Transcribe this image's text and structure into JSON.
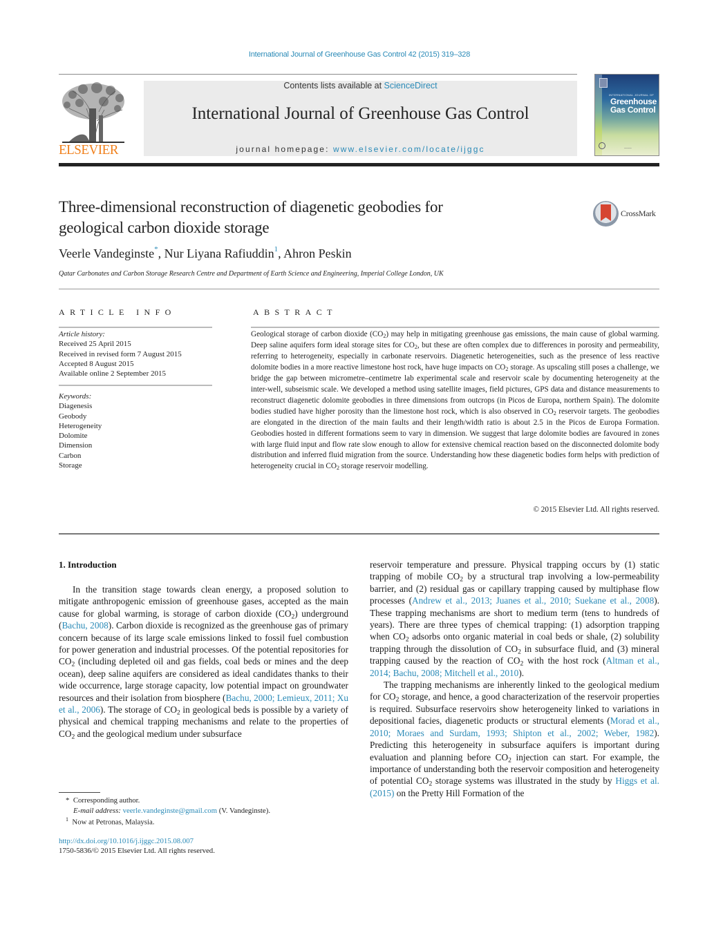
{
  "journal_citation": "International Journal of Greenhouse Gas Control 42 (2015) 319–328",
  "header": {
    "publisher_wordmark": "ELSEVIER",
    "contents_prefix": "Contents lists available at ",
    "contents_link": "ScienceDirect",
    "journal_title": "International Journal of Greenhouse Gas Control",
    "homepage_prefix": "journal homepage: ",
    "homepage_link": "www.elsevier.com/locate/ijggc",
    "cover": {
      "small_heading": "INTERNATIONAL JOURNAL OF",
      "title_line1": "Greenhouse",
      "title_line2": "Gas Control"
    }
  },
  "crossmark_label": "CrossMark",
  "article": {
    "title_line1": "Three-dimensional reconstruction of diagenetic geobodies for",
    "title_line2": "geological carbon dioxide storage",
    "authors": [
      {
        "name": "Veerle Vandeginste",
        "mark": "*"
      },
      {
        "name": "Nur Liyana Rafiuddin",
        "mark": "1"
      },
      {
        "name": "Ahron Peskin",
        "mark": ""
      }
    ],
    "affiliation": "Qatar Carbonates and Carbon Storage Research Centre and Department of Earth Science and Engineering, Imperial College London, UK"
  },
  "article_info": {
    "heading": "ARTICLE INFO",
    "history_label": "Article history:",
    "history": [
      "Received 25 April 2015",
      "Received in revised form 7 August 2015",
      "Accepted 8 August 2015",
      "Available online 2 September 2015"
    ],
    "keywords_label": "Keywords:",
    "keywords": [
      "Diagenesis",
      "Geobody",
      "Heterogeneity",
      "Dolomite",
      "Dimension",
      "Carbon",
      "Storage"
    ]
  },
  "abstract": {
    "heading": "ABSTRACT",
    "segments": [
      "Geological storage of carbon dioxide (CO",
      ") may help in mitigating greenhouse gas emissions, the main cause of global warming. Deep saline aquifers form ideal storage sites for CO",
      ", but these are often complex due to differences in porosity and permeability, referring to heterogeneity, especially in carbonate reservoirs. Diagenetic heterogeneities, such as the presence of less reactive dolomite bodies in a more reactive limestone host rock, have huge impacts on CO",
      " storage. As upscaling still poses a challenge, we bridge the gap between micrometre–centimetre lab experimental scale and reservoir scale by documenting heterogeneity at the inter-well, subseismic scale. We developed a method using satellite images, field pictures, GPS data and distance measurements to reconstruct diagenetic dolomite geobodies in three dimensions from outcrops (in Picos de Europa, northern Spain). The dolomite bodies studied have higher porosity than the limestone host rock, which is also observed in CO",
      " reservoir targets. The geobodies are elongated in the direction of the main faults and their length/width ratio is about 2.5 in the Picos de Europa Formation. Geobodies hosted in different formations seem to vary in dimension. We suggest that large dolomite bodies are favoured in zones with large fluid input and flow rate slow enough to allow for extensive chemical reaction based on the disconnected dolomite body distribution and inferred fluid migration from the source. Understanding how these diagenetic bodies form helps with prediction of heterogeneity crucial in CO",
      " storage reservoir modelling."
    ],
    "subscript": "2",
    "copyright": "© 2015 Elsevier Ltd. All rights reserved."
  },
  "introduction": {
    "heading": "1.  Introduction",
    "left_p1": [
      "In the transition stage towards clean energy, a proposed solution to mitigate anthropogenic emission of greenhouse gases, accepted as the main cause for global warming, is storage of carbon dioxide (CO",
      ") underground (",
      "). Carbon dioxide is recognized as the greenhouse gas of primary concern because of its large scale emissions linked to fossil fuel combustion for power generation and industrial processes. Of the potential repositories for CO",
      " (including depleted oil and gas fields, coal beds or mines and the deep ocean), deep saline aquifers are considered as ideal candidates thanks to their wide occurrence, large storage capacity, low potential impact on groundwater resources and their isolation from biosphere (",
      "). The storage of CO",
      " in geological beds is possible by a variety of physical and chemical trapping mechanisms and relate to the properties of CO",
      " and the geological medium under subsurface"
    ],
    "left_refs": [
      "Bachu, 2008",
      "Bachu, 2000; Lemieux, 2011; Xu et al., 2006"
    ],
    "right_p1": [
      "reservoir temperature and pressure. Physical trapping occurs by (1) static trapping of mobile CO",
      " by a structural trap involving a low-permeability barrier, and (2) residual gas or capillary trapping caused by multiphase flow processes (",
      "). These trapping mechanisms are short to medium term (tens to hundreds of years). There are three types of chemical trapping: (1) adsorption trapping when CO",
      " adsorbs onto organic material in coal beds or shale, (2) solubility trapping through the dissolution of CO",
      " in subsurface fluid, and (3) mineral trapping caused by the reaction of CO",
      " with the host rock (",
      ")."
    ],
    "right_p1_refs": [
      "Andrew et al., 2013; Juanes et al., 2010; Suekane et al., 2008",
      "Altman et al., 2014; Bachu, 2008; Mitchell et al., 2010"
    ],
    "right_p2": [
      "The trapping mechanisms are inherently linked to the geological medium for CO",
      " storage, and hence, a good characterization of the reservoir properties is required. Subsurface reservoirs show heterogeneity linked to variations in depositional facies, diagenetic products or structural elements (",
      "). Predicting this heterogeneity in subsurface aquifers is important during evaluation and planning before CO",
      " injection can start. For example, the importance of understanding both the reservoir composition and heterogeneity of potential CO",
      " storage systems was illustrated in the study by ",
      " on the Pretty Hill Formation of the"
    ],
    "right_p2_refs": [
      "Morad et al., 2010; Moraes and Surdam, 1993; Shipton et al., 2002; Weber, 1982",
      "Higgs et al. (2015)"
    ]
  },
  "footnotes": {
    "corresponding_mark": "*",
    "corresponding": "Corresponding author.",
    "email_label": "E-mail address:",
    "email": "veerle.vandeginste@gmail.com",
    "email_owner": " (V. Vandeginste).",
    "note1_mark": "1",
    "note1": "Now at Petronas, Malaysia.",
    "doi": "http://dx.doi.org/10.1016/j.ijggc.2015.08.007",
    "issn": "1750-5836/© 2015 Elsevier Ltd. All rights reserved."
  }
}
